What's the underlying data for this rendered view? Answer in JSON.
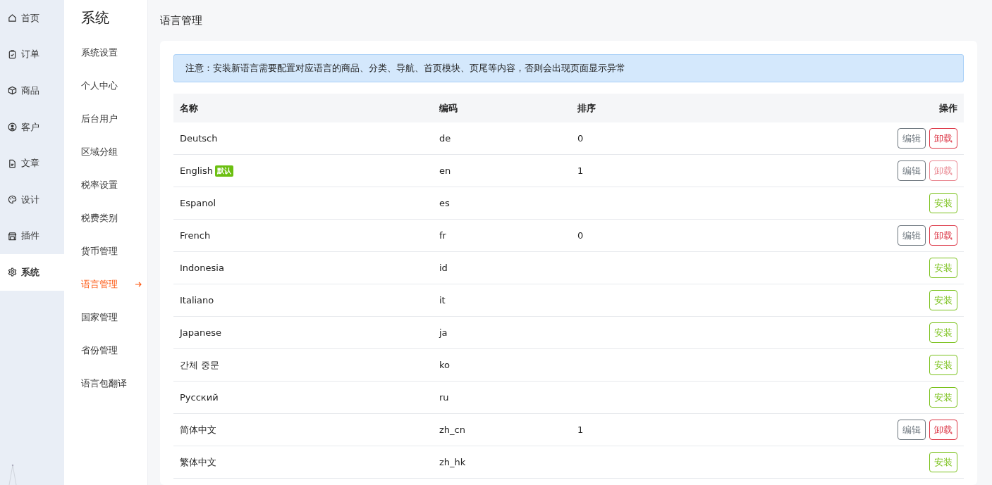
{
  "nav": {
    "items": [
      {
        "label": "首页",
        "selected": false
      },
      {
        "label": "订单",
        "selected": false
      },
      {
        "label": "商品",
        "selected": false
      },
      {
        "label": "客户",
        "selected": false
      },
      {
        "label": "文章",
        "selected": false
      },
      {
        "label": "设计",
        "selected": false
      },
      {
        "label": "插件",
        "selected": false
      },
      {
        "label": "系统",
        "selected": true
      }
    ]
  },
  "submenu": {
    "title": "系统",
    "items": [
      {
        "label": "系统设置",
        "selected": false
      },
      {
        "label": "个人中心",
        "selected": false
      },
      {
        "label": "后台用户",
        "selected": false
      },
      {
        "label": "区域分组",
        "selected": false
      },
      {
        "label": "税率设置",
        "selected": false
      },
      {
        "label": "税费类别",
        "selected": false
      },
      {
        "label": "货币管理",
        "selected": false
      },
      {
        "label": "语言管理",
        "selected": true
      },
      {
        "label": "国家管理",
        "selected": false
      },
      {
        "label": "省份管理",
        "selected": false
      },
      {
        "label": "语言包翻译",
        "selected": false
      }
    ]
  },
  "page": {
    "title": "语言管理"
  },
  "alert": {
    "text": "注意：安装新语言需要配置对应语言的商品、分类、导航、首页模块、页尾等内容，否则会出现页面显示异常"
  },
  "table": {
    "columns": [
      "名称",
      "编码",
      "排序",
      "操作"
    ],
    "rows": [
      {
        "name": "Deutsch",
        "code": "de",
        "sort": "0",
        "actions": [
          {
            "label": "编辑",
            "kind": "edit",
            "disabled": false
          },
          {
            "label": "卸载",
            "kind": "uninstall",
            "disabled": false
          }
        ]
      },
      {
        "name": "English",
        "badge": "默认",
        "code": "en",
        "sort": "1",
        "actions": [
          {
            "label": "编辑",
            "kind": "edit",
            "disabled": false
          },
          {
            "label": "卸载",
            "kind": "uninstall",
            "disabled": true
          }
        ]
      },
      {
        "name": "Espanol",
        "code": "es",
        "actions": [
          {
            "label": "安装",
            "kind": "install",
            "disabled": false
          }
        ]
      },
      {
        "name": "French",
        "code": "fr",
        "sort": "0",
        "actions": [
          {
            "label": "编辑",
            "kind": "edit",
            "disabled": false
          },
          {
            "label": "卸载",
            "kind": "uninstall",
            "disabled": false
          }
        ]
      },
      {
        "name": "Indonesia",
        "code": "id",
        "actions": [
          {
            "label": "安装",
            "kind": "install",
            "disabled": false
          }
        ]
      },
      {
        "name": "Italiano",
        "code": "it",
        "actions": [
          {
            "label": "安装",
            "kind": "install",
            "disabled": false
          }
        ]
      },
      {
        "name": "Japanese",
        "code": "ja",
        "actions": [
          {
            "label": "安装",
            "kind": "install",
            "disabled": false
          }
        ]
      },
      {
        "name": "간체 중문",
        "code": "ko",
        "actions": [
          {
            "label": "安装",
            "kind": "install",
            "disabled": false
          }
        ]
      },
      {
        "name": "Русский",
        "code": "ru",
        "actions": [
          {
            "label": "安装",
            "kind": "install",
            "disabled": false
          }
        ]
      },
      {
        "name": "简体中文",
        "code": "zh_cn",
        "sort": "1",
        "actions": [
          {
            "label": "编辑",
            "kind": "edit",
            "disabled": false
          },
          {
            "label": "卸载",
            "kind": "uninstall",
            "disabled": false
          }
        ]
      },
      {
        "name": "繁体中文",
        "code": "zh_hk",
        "actions": [
          {
            "label": "安装",
            "kind": "install",
            "disabled": false
          }
        ]
      }
    ]
  }
}
